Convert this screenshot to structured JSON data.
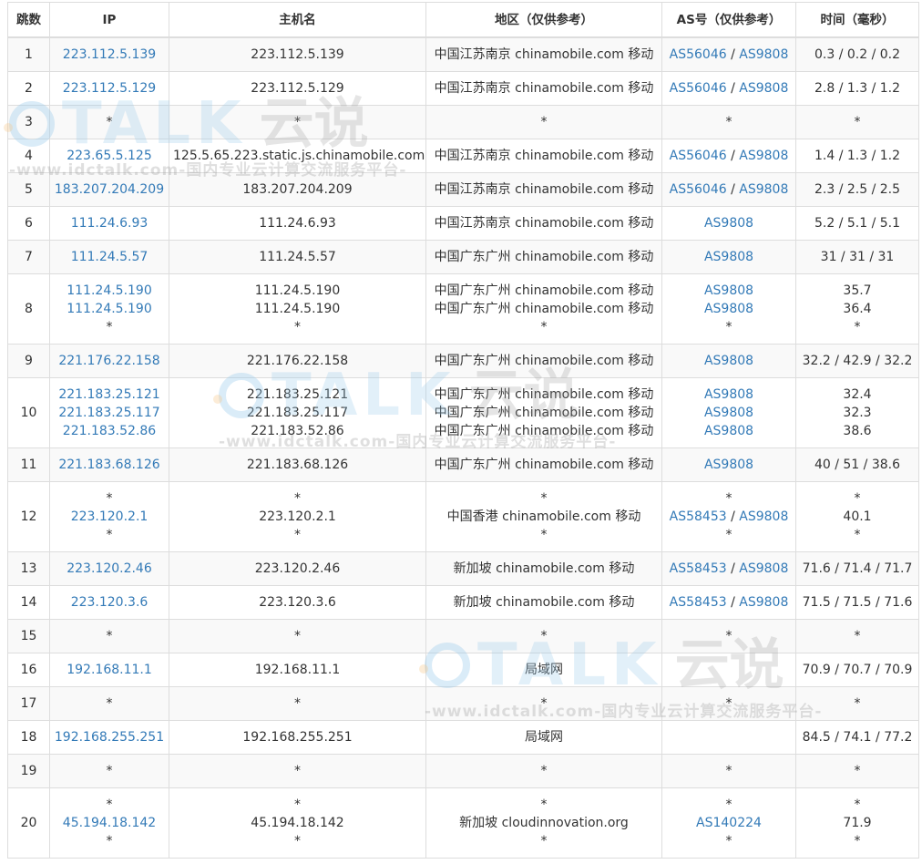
{
  "headers": {
    "hop": "跳数",
    "ip": "IP",
    "host": "主机名",
    "region": "地区（仅供参考）",
    "asn": "AS号（仅供参考）",
    "time": "时间（毫秒）"
  },
  "rows": [
    {
      "hop": "1",
      "ips": [
        "223.112.5.139"
      ],
      "hosts": [
        "223.112.5.139"
      ],
      "regions": [
        "中国江苏南京 chinamobile.com 移动"
      ],
      "as": [
        [
          "AS56046",
          "AS9808"
        ]
      ],
      "times": [
        "0.3 / 0.2 / 0.2"
      ]
    },
    {
      "hop": "2",
      "ips": [
        "223.112.5.129"
      ],
      "hosts": [
        "223.112.5.129"
      ],
      "regions": [
        "中国江苏南京 chinamobile.com 移动"
      ],
      "as": [
        [
          "AS56046",
          "AS9808"
        ]
      ],
      "times": [
        "2.8 / 1.3 / 1.2"
      ]
    },
    {
      "hop": "3",
      "ips": [
        "*"
      ],
      "hosts": [
        "*"
      ],
      "regions": [
        "*"
      ],
      "as": [
        [
          "*"
        ]
      ],
      "times": [
        "*"
      ]
    },
    {
      "hop": "4",
      "ips": [
        "223.65.5.125"
      ],
      "hosts": [
        "125.5.65.223.static.js.chinamobile.com"
      ],
      "regions": [
        "中国江苏南京 chinamobile.com 移动"
      ],
      "as": [
        [
          "AS56046",
          "AS9808"
        ]
      ],
      "times": [
        "1.4 / 1.3 / 1.2"
      ]
    },
    {
      "hop": "5",
      "ips": [
        "183.207.204.209"
      ],
      "hosts": [
        "183.207.204.209"
      ],
      "regions": [
        "中国江苏南京 chinamobile.com 移动"
      ],
      "as": [
        [
          "AS56046",
          "AS9808"
        ]
      ],
      "times": [
        "2.3 / 2.5 / 2.5"
      ]
    },
    {
      "hop": "6",
      "ips": [
        "111.24.6.93"
      ],
      "hosts": [
        "111.24.6.93"
      ],
      "regions": [
        "中国江苏南京 chinamobile.com 移动"
      ],
      "as": [
        [
          "AS9808"
        ]
      ],
      "times": [
        "5.2 / 5.1 / 5.1"
      ]
    },
    {
      "hop": "7",
      "ips": [
        "111.24.5.57"
      ],
      "hosts": [
        "111.24.5.57"
      ],
      "regions": [
        "中国广东广州 chinamobile.com 移动"
      ],
      "as": [
        [
          "AS9808"
        ]
      ],
      "times": [
        "31 / 31 / 31"
      ]
    },
    {
      "hop": "8",
      "ips": [
        "111.24.5.190",
        "111.24.5.190",
        "*"
      ],
      "hosts": [
        "111.24.5.190",
        "111.24.5.190",
        "*"
      ],
      "regions": [
        "中国广东广州 chinamobile.com 移动",
        "中国广东广州 chinamobile.com 移动",
        "*"
      ],
      "as": [
        [
          "AS9808"
        ],
        [
          "AS9808"
        ],
        [
          "*"
        ]
      ],
      "times": [
        "35.7",
        "36.4",
        "*"
      ]
    },
    {
      "hop": "9",
      "ips": [
        "221.176.22.158"
      ],
      "hosts": [
        "221.176.22.158"
      ],
      "regions": [
        "中国广东广州 chinamobile.com 移动"
      ],
      "as": [
        [
          "AS9808"
        ]
      ],
      "times": [
        "32.2 / 42.9 / 32.2"
      ]
    },
    {
      "hop": "10",
      "ips": [
        "221.183.25.121",
        "221.183.25.117",
        "221.183.52.86"
      ],
      "hosts": [
        "221.183.25.121",
        "221.183.25.117",
        "221.183.52.86"
      ],
      "regions": [
        "中国广东广州 chinamobile.com 移动",
        "中国广东广州 chinamobile.com 移动",
        "中国广东广州 chinamobile.com 移动"
      ],
      "as": [
        [
          "AS9808"
        ],
        [
          "AS9808"
        ],
        [
          "AS9808"
        ]
      ],
      "times": [
        "32.4",
        "32.3",
        "38.6"
      ]
    },
    {
      "hop": "11",
      "ips": [
        "221.183.68.126"
      ],
      "hosts": [
        "221.183.68.126"
      ],
      "regions": [
        "中国广东广州 chinamobile.com 移动"
      ],
      "as": [
        [
          "AS9808"
        ]
      ],
      "times": [
        "40 / 51 / 38.6"
      ]
    },
    {
      "hop": "12",
      "ips": [
        "*",
        "223.120.2.1",
        "*"
      ],
      "hosts": [
        "*",
        "223.120.2.1",
        "*"
      ],
      "regions": [
        "*",
        "中国香港 chinamobile.com 移动",
        "*"
      ],
      "as": [
        [
          "*"
        ],
        [
          "AS58453",
          "AS9808"
        ],
        [
          "*"
        ]
      ],
      "times": [
        "*",
        "40.1",
        "*"
      ]
    },
    {
      "hop": "13",
      "ips": [
        "223.120.2.46"
      ],
      "hosts": [
        "223.120.2.46"
      ],
      "regions": [
        "新加坡 chinamobile.com 移动"
      ],
      "as": [
        [
          "AS58453",
          "AS9808"
        ]
      ],
      "times": [
        "71.6 / 71.4 / 71.7"
      ]
    },
    {
      "hop": "14",
      "ips": [
        "223.120.3.6"
      ],
      "hosts": [
        "223.120.3.6"
      ],
      "regions": [
        "新加坡 chinamobile.com 移动"
      ],
      "as": [
        [
          "AS58453",
          "AS9808"
        ]
      ],
      "times": [
        "71.5 / 71.5 / 71.6"
      ]
    },
    {
      "hop": "15",
      "ips": [
        "*"
      ],
      "hosts": [
        "*"
      ],
      "regions": [
        "*"
      ],
      "as": [
        [
          "*"
        ]
      ],
      "times": [
        "*"
      ]
    },
    {
      "hop": "16",
      "ips": [
        "192.168.11.1"
      ],
      "hosts": [
        "192.168.11.1"
      ],
      "regions": [
        "局域网"
      ],
      "as": [
        [
          ""
        ]
      ],
      "times": [
        "70.9 / 70.7 / 70.9"
      ]
    },
    {
      "hop": "17",
      "ips": [
        "*"
      ],
      "hosts": [
        "*"
      ],
      "regions": [
        "*"
      ],
      "as": [
        [
          "*"
        ]
      ],
      "times": [
        "*"
      ]
    },
    {
      "hop": "18",
      "ips": [
        "192.168.255.251"
      ],
      "hosts": [
        "192.168.255.251"
      ],
      "regions": [
        "局域网"
      ],
      "as": [
        [
          ""
        ]
      ],
      "times": [
        "84.5 / 74.1 / 77.2"
      ]
    },
    {
      "hop": "19",
      "ips": [
        "*"
      ],
      "hosts": [
        "*"
      ],
      "regions": [
        "*"
      ],
      "as": [
        [
          "*"
        ]
      ],
      "times": [
        "*"
      ]
    },
    {
      "hop": "20",
      "ips": [
        "*",
        "45.194.18.142",
        "*"
      ],
      "hosts": [
        "*",
        "45.194.18.142",
        "*"
      ],
      "regions": [
        "*",
        "新加坡 cloudinnovation.org",
        "*"
      ],
      "as": [
        [
          "*"
        ],
        [
          "AS140224"
        ],
        [
          "*"
        ]
      ],
      "times": [
        "*",
        "71.9",
        "*"
      ]
    }
  ],
  "watermark": {
    "brand": "TALK",
    "brand_cn": "云说",
    "url_text": "-www.idctalk.com-国内专业云计算交流服务平台-"
  },
  "colors": {
    "link": "#337ab7",
    "text": "#333333",
    "border": "#dddddd",
    "stripe": "#f9f9f9"
  }
}
